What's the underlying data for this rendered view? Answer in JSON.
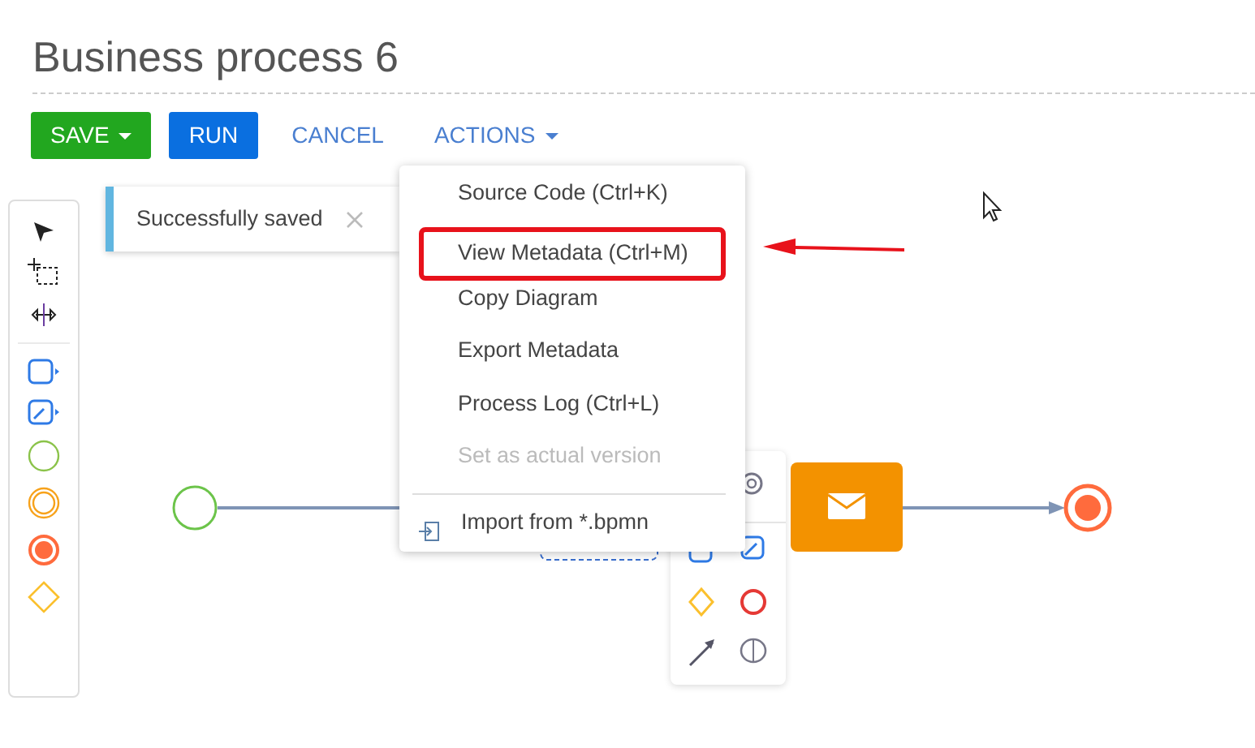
{
  "title": "Business process 6",
  "buttons": [
    {
      "label": "SAVE",
      "kind": "success",
      "dropdown": true
    },
    {
      "label": "RUN",
      "kind": "primary",
      "dropdown": false
    },
    {
      "label": "CANCEL",
      "kind": "link",
      "dropdown": false
    },
    {
      "label": "ACTIONS",
      "kind": "link",
      "dropdown": true
    }
  ],
  "toast": {
    "message": "Successfully saved"
  },
  "menu": [
    {
      "label": "Source Code (Ctrl+K)",
      "disabled": false,
      "highlighted": false
    },
    {
      "label": "View Metadata (Ctrl+M)",
      "disabled": false,
      "highlighted": true
    },
    {
      "label": "Copy Diagram",
      "disabled": false,
      "highlighted": false
    },
    {
      "label": "Export Metadata",
      "disabled": false,
      "highlighted": false
    },
    {
      "label": "Process Log (Ctrl+L)",
      "disabled": false,
      "highlighted": false
    },
    {
      "label": "Set as actual version",
      "disabled": true,
      "highlighted": false
    },
    {
      "label": "Import from *.bpmn",
      "disabled": false,
      "highlighted": false,
      "kind": "import"
    }
  ]
}
